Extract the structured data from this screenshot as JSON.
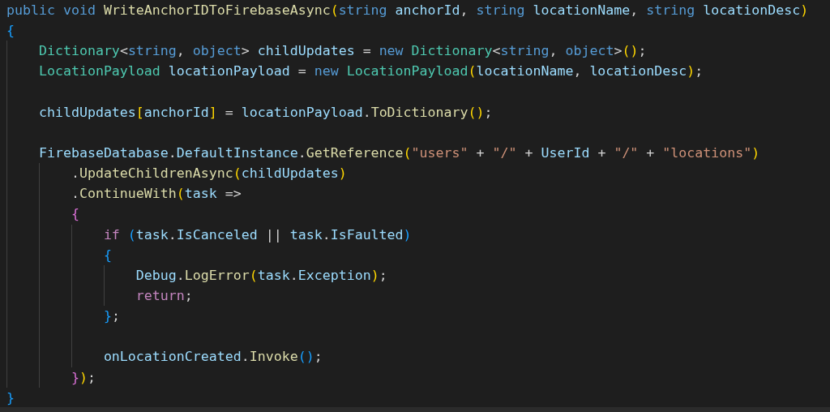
{
  "editor": {
    "lines": [
      {
        "kind": "code",
        "tokens": [
          {
            "kind": "kw",
            "text": "public "
          },
          {
            "kind": "kw",
            "text": "void "
          },
          {
            "kind": "fn",
            "text": "WriteAnchorIDToFirebaseAsync"
          },
          {
            "kind": "b1",
            "text": "("
          },
          {
            "kind": "kw",
            "text": "string "
          },
          {
            "kind": "var",
            "text": "anchorId"
          },
          {
            "kind": "plain",
            "text": ", "
          },
          {
            "kind": "kw",
            "text": "string "
          },
          {
            "kind": "var",
            "text": "locationName"
          },
          {
            "kind": "plain",
            "text": ", "
          },
          {
            "kind": "kw",
            "text": "string "
          },
          {
            "kind": "var",
            "text": "locationDesc"
          },
          {
            "kind": "b1",
            "text": ")"
          }
        ]
      },
      {
        "kind": "code",
        "tokens": [
          {
            "kind": "b3",
            "text": "{"
          }
        ]
      },
      {
        "kind": "code",
        "tokens": [
          {
            "kind": "type",
            "text": "    Dictionary"
          },
          {
            "kind": "plain",
            "text": "<"
          },
          {
            "kind": "kw",
            "text": "string"
          },
          {
            "kind": "plain",
            "text": ", "
          },
          {
            "kind": "kw",
            "text": "object"
          },
          {
            "kind": "plain",
            "text": "> "
          },
          {
            "kind": "var",
            "text": "childUpdates"
          },
          {
            "kind": "plain",
            "text": " = "
          },
          {
            "kind": "kw",
            "text": "new "
          },
          {
            "kind": "type",
            "text": "Dictionary"
          },
          {
            "kind": "plain",
            "text": "<"
          },
          {
            "kind": "kw",
            "text": "string"
          },
          {
            "kind": "plain",
            "text": ", "
          },
          {
            "kind": "kw",
            "text": "object"
          },
          {
            "kind": "plain",
            "text": ">"
          },
          {
            "kind": "b1",
            "text": "()"
          },
          {
            "kind": "plain",
            "text": ";"
          }
        ]
      },
      {
        "kind": "code",
        "tokens": [
          {
            "kind": "type",
            "text": "    LocationPayload"
          },
          {
            "kind": "var",
            "text": " locationPayload"
          },
          {
            "kind": "plain",
            "text": " = "
          },
          {
            "kind": "kw",
            "text": "new "
          },
          {
            "kind": "type",
            "text": "LocationPayload"
          },
          {
            "kind": "b1",
            "text": "("
          },
          {
            "kind": "var",
            "text": "locationName"
          },
          {
            "kind": "plain",
            "text": ", "
          },
          {
            "kind": "var",
            "text": "locationDesc"
          },
          {
            "kind": "b1",
            "text": ")"
          },
          {
            "kind": "plain",
            "text": ";"
          }
        ]
      },
      {
        "kind": "blank"
      },
      {
        "kind": "code",
        "tokens": [
          {
            "kind": "var",
            "text": "    childUpdates"
          },
          {
            "kind": "b1",
            "text": "["
          },
          {
            "kind": "var",
            "text": "anchorId"
          },
          {
            "kind": "b1",
            "text": "]"
          },
          {
            "kind": "plain",
            "text": " = "
          },
          {
            "kind": "var",
            "text": "locationPayload"
          },
          {
            "kind": "plain",
            "text": "."
          },
          {
            "kind": "fn",
            "text": "ToDictionary"
          },
          {
            "kind": "b1",
            "text": "()"
          },
          {
            "kind": "plain",
            "text": ";"
          }
        ]
      },
      {
        "kind": "blank"
      },
      {
        "kind": "code",
        "tokens": [
          {
            "kind": "var",
            "text": "    FirebaseDatabase"
          },
          {
            "kind": "plain",
            "text": "."
          },
          {
            "kind": "var",
            "text": "DefaultInstance"
          },
          {
            "kind": "plain",
            "text": "."
          },
          {
            "kind": "fn",
            "text": "GetReference"
          },
          {
            "kind": "b1",
            "text": "("
          },
          {
            "kind": "str",
            "text": "\"users\""
          },
          {
            "kind": "plain",
            "text": " + "
          },
          {
            "kind": "str",
            "text": "\"/\""
          },
          {
            "kind": "plain",
            "text": " + "
          },
          {
            "kind": "var",
            "text": "UserId"
          },
          {
            "kind": "plain",
            "text": " + "
          },
          {
            "kind": "str",
            "text": "\"/\""
          },
          {
            "kind": "plain",
            "text": " + "
          },
          {
            "kind": "str",
            "text": "\"locations\""
          },
          {
            "kind": "b1",
            "text": ")"
          }
        ]
      },
      {
        "kind": "code",
        "tokens": [
          {
            "kind": "plain",
            "text": "        ."
          },
          {
            "kind": "fn",
            "text": "UpdateChildrenAsync"
          },
          {
            "kind": "b1",
            "text": "("
          },
          {
            "kind": "var",
            "text": "childUpdates"
          },
          {
            "kind": "b1",
            "text": ")"
          }
        ]
      },
      {
        "kind": "code",
        "tokens": [
          {
            "kind": "plain",
            "text": "        ."
          },
          {
            "kind": "fn",
            "text": "ContinueWith"
          },
          {
            "kind": "b1",
            "text": "("
          },
          {
            "kind": "var",
            "text": "task"
          },
          {
            "kind": "plain",
            "text": " =>"
          }
        ]
      },
      {
        "kind": "code",
        "tokens": [
          {
            "kind": "b2",
            "text": "        {"
          }
        ]
      },
      {
        "kind": "code",
        "tokens": [
          {
            "kind": "ctl",
            "text": "            if "
          },
          {
            "kind": "b3",
            "text": "("
          },
          {
            "kind": "var",
            "text": "task"
          },
          {
            "kind": "plain",
            "text": "."
          },
          {
            "kind": "var",
            "text": "IsCanceled"
          },
          {
            "kind": "plain",
            "text": " || "
          },
          {
            "kind": "var",
            "text": "task"
          },
          {
            "kind": "plain",
            "text": "."
          },
          {
            "kind": "var",
            "text": "IsFaulted"
          },
          {
            "kind": "b3",
            "text": ")"
          }
        ]
      },
      {
        "kind": "code",
        "tokens": [
          {
            "kind": "b3",
            "text": "            {"
          }
        ]
      },
      {
        "kind": "code",
        "tokens": [
          {
            "kind": "var",
            "text": "                Debug"
          },
          {
            "kind": "plain",
            "text": "."
          },
          {
            "kind": "fn",
            "text": "LogError"
          },
          {
            "kind": "b1",
            "text": "("
          },
          {
            "kind": "var",
            "text": "task"
          },
          {
            "kind": "plain",
            "text": "."
          },
          {
            "kind": "var",
            "text": "Exception"
          },
          {
            "kind": "b1",
            "text": ")"
          },
          {
            "kind": "plain",
            "text": ";"
          }
        ]
      },
      {
        "kind": "code",
        "tokens": [
          {
            "kind": "ctl",
            "text": "                return"
          },
          {
            "kind": "plain",
            "text": ";"
          }
        ]
      },
      {
        "kind": "code",
        "tokens": [
          {
            "kind": "b3",
            "text": "            }"
          },
          {
            "kind": "plain",
            "text": ";"
          }
        ]
      },
      {
        "kind": "blank"
      },
      {
        "kind": "code",
        "tokens": [
          {
            "kind": "var",
            "text": "            onLocationCreated"
          },
          {
            "kind": "plain",
            "text": "."
          },
          {
            "kind": "fn",
            "text": "Invoke"
          },
          {
            "kind": "b3",
            "text": "()"
          },
          {
            "kind": "plain",
            "text": ";"
          }
        ]
      },
      {
        "kind": "code",
        "tokens": [
          {
            "kind": "b2",
            "text": "        }"
          },
          {
            "kind": "b1",
            "text": ")"
          },
          {
            "kind": "plain",
            "text": ";"
          }
        ]
      },
      {
        "kind": "code",
        "tokens": [
          {
            "kind": "b3",
            "text": "}"
          }
        ]
      }
    ]
  }
}
